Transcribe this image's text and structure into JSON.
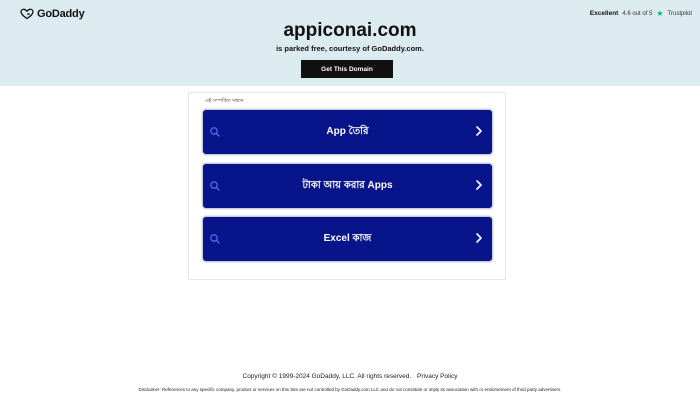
{
  "header": {
    "brand": "GoDaddy",
    "trustpilot": {
      "rating_word": "Excellent",
      "score_text": "4.6 out of 5",
      "provider": "Trustpilot"
    }
  },
  "parked": {
    "domain": "appiconai.com",
    "tagline": "is parked free, courtesy of GoDaddy.com.",
    "cta": "Get This Domain"
  },
  "related": {
    "label": "এই সম্পর্কিত সন্ধান",
    "links": [
      {
        "label": "App তৈরি"
      },
      {
        "label": "টাকা আয় করার Apps"
      },
      {
        "label": "Excel কাজ"
      }
    ]
  },
  "footer": {
    "copyright": "Copyright © 1999-2024 GoDaddy, LLC. All rights reserved.",
    "privacy": "Privacy Policy",
    "disclaimer": "Disclaimer: References to any specific company, product or services on this Site are not controlled by GoDaddy.com LLC and do not constitute or imply its association with or endorsement of third party advertisers."
  },
  "colors": {
    "header_bg": "#dcebef",
    "link_bg": "#08148a",
    "cta_bg": "#111111",
    "trustpilot_green": "#00b67a"
  }
}
